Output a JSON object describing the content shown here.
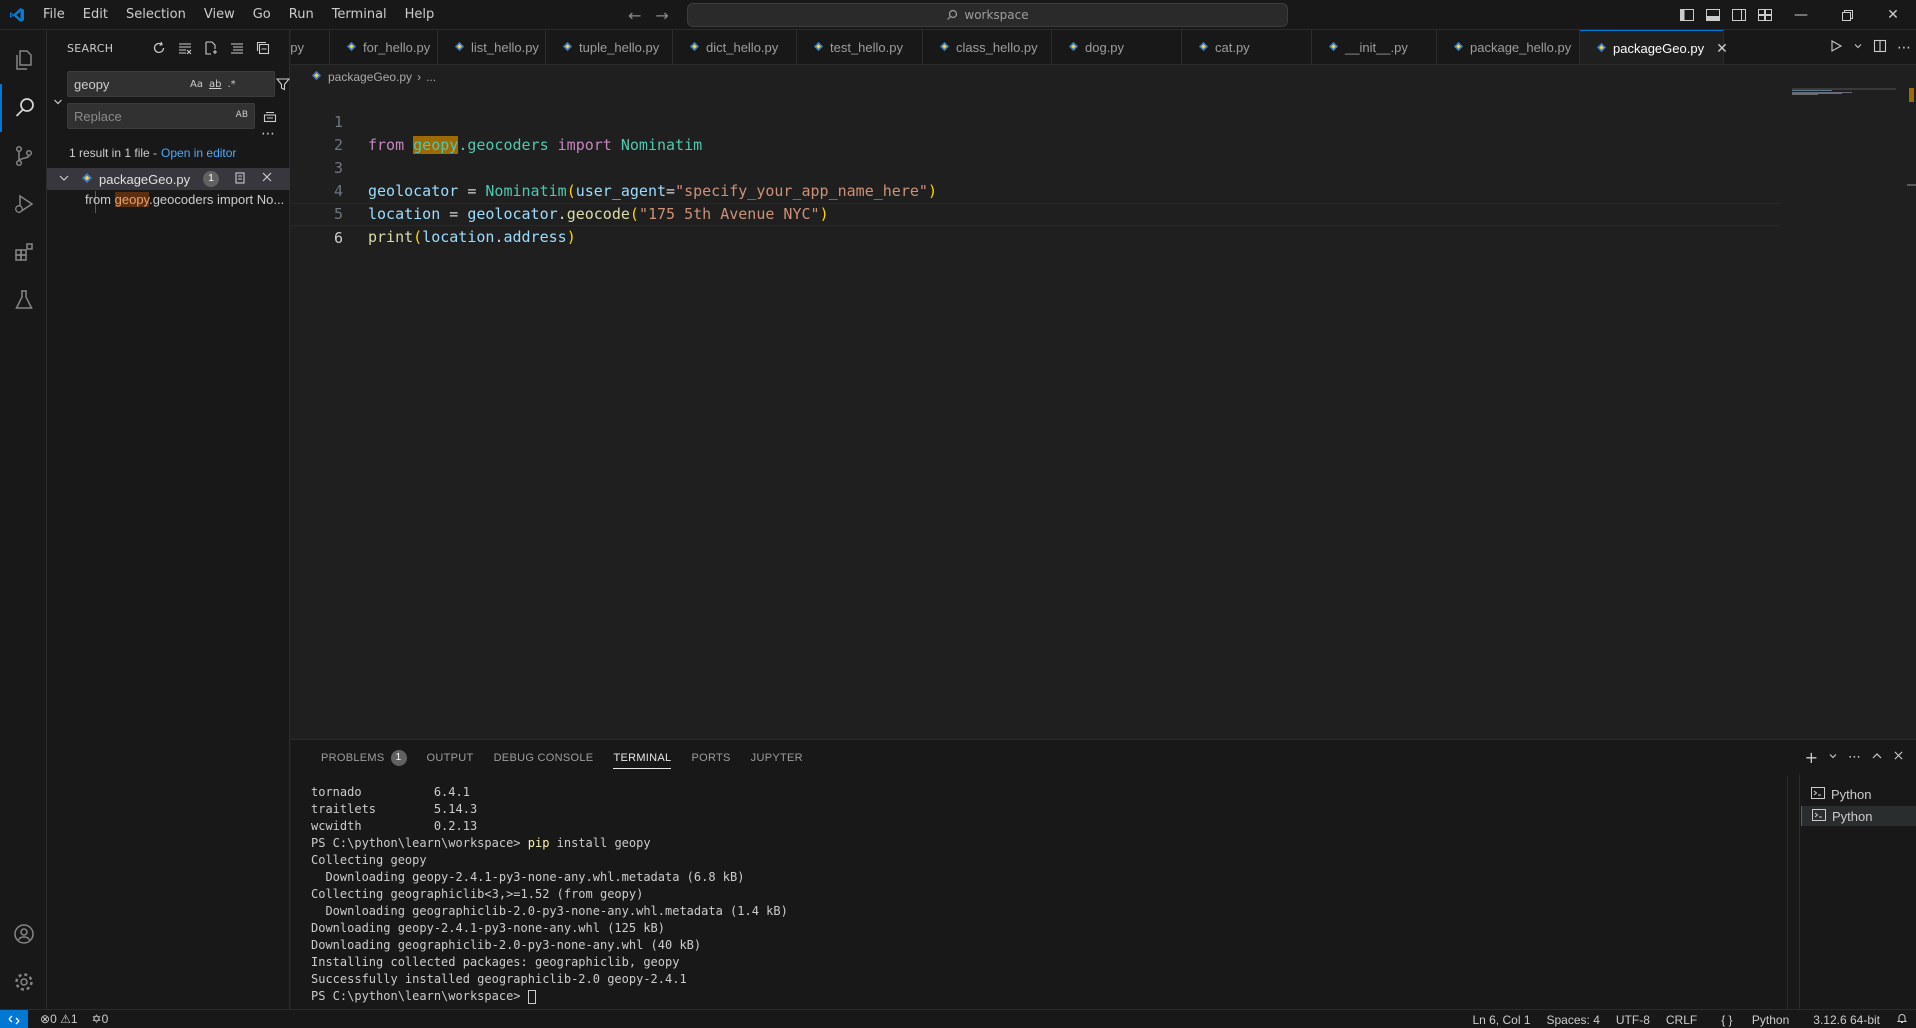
{
  "titlebar": {
    "menu": [
      "File",
      "Edit",
      "Selection",
      "View",
      "Go",
      "Run",
      "Terminal",
      "Help"
    ],
    "command_center": "workspace"
  },
  "sidebar": {
    "title": "SEARCH",
    "search_value": "geopy",
    "replace_placeholder": "Replace",
    "search_opts": [
      "Aa",
      "ab",
      ".*"
    ],
    "replace_opt": "AB",
    "results_summary": "1 result in 1 file -",
    "open_in_editor": "Open in editor",
    "file": {
      "name": "packageGeo.py",
      "count": "1"
    },
    "match": {
      "before": "from ",
      "hit": "geopy",
      "after": ".geocoders import No..."
    }
  },
  "tabs": [
    {
      "label": "..py"
    },
    {
      "label": "for_hello.py"
    },
    {
      "label": "list_hello.py"
    },
    {
      "label": "tuple_hello.py"
    },
    {
      "label": "dict_hello.py"
    },
    {
      "label": "test_hello.py"
    },
    {
      "label": "class_hello.py"
    },
    {
      "label": "dog.py"
    },
    {
      "label": "cat.py"
    },
    {
      "label": "__init__.py"
    },
    {
      "label": "package_hello.py"
    },
    {
      "label": "packageGeo.py"
    }
  ],
  "breadcrumb": {
    "file": "packageGeo.py",
    "rest": "..."
  },
  "code": {
    "line_numbers": [
      "1",
      "2",
      "3",
      "4",
      "5",
      "6"
    ],
    "l1": {
      "from": "from",
      "mod": "geopy",
      "rest": ".geocoders",
      "import": "import",
      "cls": "Nominatim"
    },
    "l3": {
      "var": "geolocator",
      "eq": " = ",
      "cls": "Nominatim",
      "p1": "(",
      "arg": "user_agent",
      "eq2": "=",
      "str": "\"specify_your_app_name_here\"",
      "p2": ")"
    },
    "l4": {
      "var": "location",
      "eq": " = ",
      "obj": "geolocator",
      "dot": ".",
      "fn": "geocode",
      "p1": "(",
      "str": "\"175 5th Avenue NYC\"",
      "p2": ")"
    },
    "l5": {
      "fn": "print",
      "p1": "(",
      "obj": "location",
      "dot": ".",
      "attr": "address",
      "p2": ")"
    }
  },
  "panel": {
    "tabs": [
      "PROBLEMS",
      "OUTPUT",
      "DEBUG CONSOLE",
      "TERMINAL",
      "PORTS",
      "JUPYTER"
    ],
    "problems_count": "1",
    "terminal_lines": [
      "tornado          6.4.1",
      "traitlets        5.14.3",
      "wcwidth          0.2.13"
    ],
    "prompt": "PS C:\\python\\learn\\workspace> ",
    "cmd_pip": "pip",
    "cmd_rest": " install geopy",
    "output_lines": [
      "Collecting geopy",
      "  Downloading geopy-2.4.1-py3-none-any.whl.metadata (6.8 kB)",
      "Collecting geographiclib<3,>=1.52 (from geopy)",
      "  Downloading geographiclib-2.0-py3-none-any.whl.metadata (1.4 kB)",
      "Downloading geopy-2.4.1-py3-none-any.whl (125 kB)",
      "Downloading geographiclib-2.0-py3-none-any.whl (40 kB)",
      "Installing collected packages: geographiclib, geopy",
      "Successfully installed geographiclib-2.0 geopy-2.4.1"
    ],
    "final_prompt": "PS C:\\python\\learn\\workspace> ",
    "terminal_list": [
      "Python",
      "Python"
    ]
  },
  "statusbar": {
    "errors": "0",
    "warnings": "1",
    "ports": "0",
    "position": "Ln 6, Col 1",
    "spaces": "Spaces: 4",
    "encoding": "UTF-8",
    "eol": "CRLF",
    "language": "Python",
    "interpreter": "3.12.6 64-bit"
  },
  "colors": {
    "accent": "#0078d4",
    "find_highlight": "#9e6a03"
  }
}
